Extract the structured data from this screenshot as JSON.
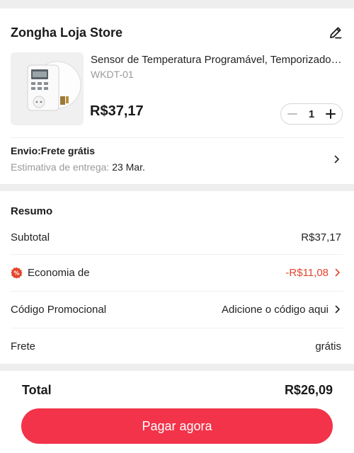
{
  "store": {
    "name": "Zongha Loja Store",
    "edit_icon": "pencil-icon"
  },
  "product": {
    "title": "Sensor de Temperatura Programável, Temporizador Digital",
    "sku": "WKDT-01",
    "price": "R$37,17",
    "quantity": "1",
    "minus_icon": "minus-icon",
    "plus_icon": "plus-icon"
  },
  "shipping": {
    "title": "Envio:Frete grátis",
    "estimate_label": "Estimativa de entrega: ",
    "estimate_date": "23 Mar.",
    "chevron_icon": "chevron-right-icon"
  },
  "summary": {
    "title": "Resumo",
    "subtotal_label": "Subtotal",
    "subtotal_value": "R$37,17",
    "savings_label": "Economia de",
    "savings_value": "-R$11,08",
    "promo_label": "Código Promocional",
    "promo_value": "Adicione o código aqui",
    "freight_label": "Frete",
    "freight_value": "grátis"
  },
  "footer": {
    "total_label": "Total",
    "total_value": "R$26,09",
    "pay_label": "Pagar agora"
  },
  "colors": {
    "accent": "#f2334a",
    "discount_red": "#e2452b",
    "muted_text": "#9a9a9a"
  }
}
